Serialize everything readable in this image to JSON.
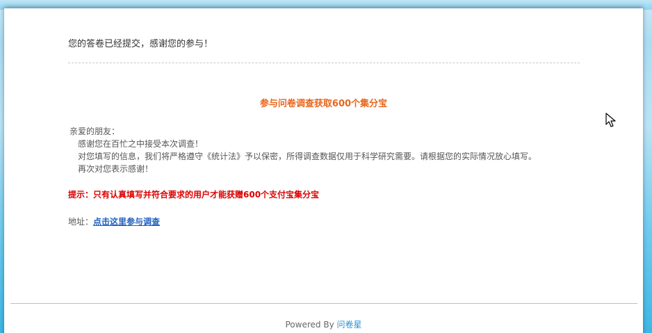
{
  "confirmation": {
    "message": "您的答卷已经提交，感谢您的参与！"
  },
  "promo": {
    "title": "参与问卷调查获取600个集分宝",
    "greeting": "亲爱的朋友：",
    "lines": [
      "感谢您在百忙之中接受本次调查！",
      "对您填写的信息，我们将严格遵守《统计法》予以保密，所得调查数据仅用于科学研究需要。请根据您的实际情况放心填写。",
      "再次对您表示感谢！"
    ],
    "tip": "提示：只有认真填写并符合要求的用户才能获赠600个支付宝集分宝",
    "address_label": "地址：",
    "address_link": "点击这里参与调查"
  },
  "footer": {
    "powered_by": "Powered By ",
    "brand": "问卷星"
  },
  "colors": {
    "promo_title": "#e8651a",
    "tip": "#dd0000",
    "link": "#1f5fbf",
    "brand_link": "#2a8fd0"
  },
  "icons": {
    "cursor": "mouse-pointer-icon"
  }
}
